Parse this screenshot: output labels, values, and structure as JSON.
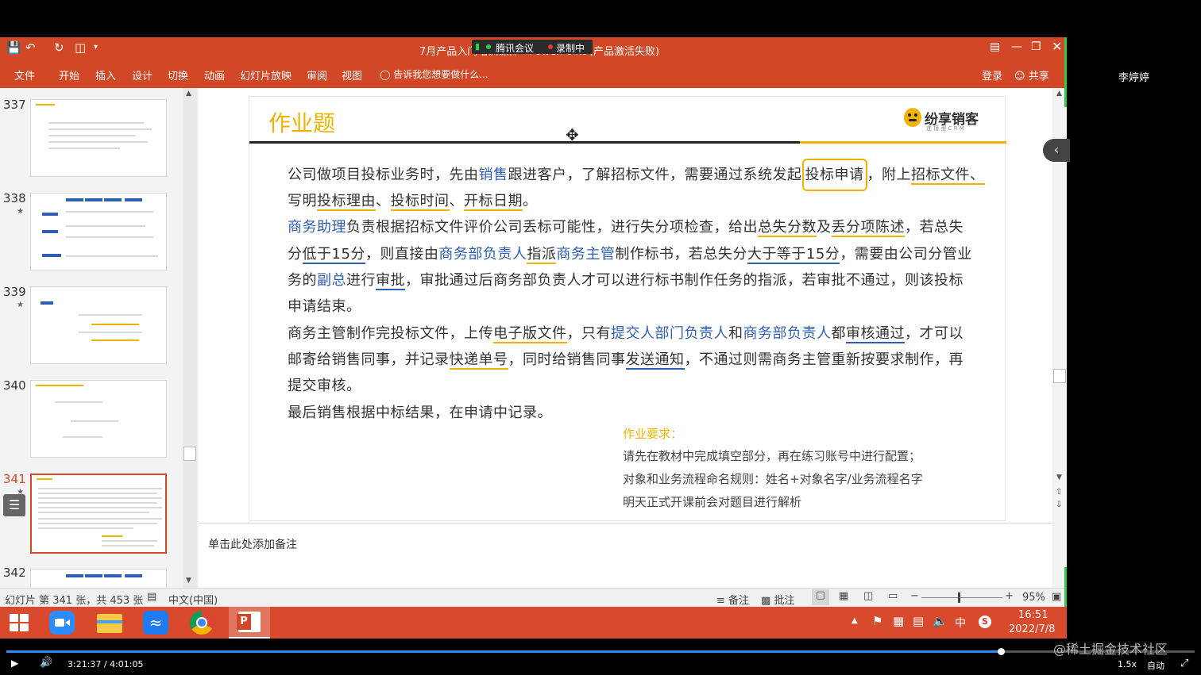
{
  "window": {
    "title": "7月产品入门培训课件 - PowerPoint (产品激活失败)",
    "login": "登录",
    "share": "共享"
  },
  "meeting": {
    "app": "腾讯会议",
    "recording": "录制中"
  },
  "participant": "李婷婷",
  "ribbon_tabs": [
    "文件",
    "开始",
    "插入",
    "设计",
    "切换",
    "动画",
    "幻灯片放映",
    "审阅",
    "视图"
  ],
  "tellme": "告诉我您想要做什么...",
  "thumbnails": [
    {
      "num": "337",
      "star": ""
    },
    {
      "num": "338",
      "star": "★"
    },
    {
      "num": "339",
      "star": "★"
    },
    {
      "num": "340",
      "star": ""
    },
    {
      "num": "341",
      "star": "★"
    },
    {
      "num": "342",
      "star": ""
    }
  ],
  "slide": {
    "title": "作业题",
    "logo_text": "纷享销客",
    "logo_sub": "连 接 型 C R M",
    "paragraph_lines": {
      "l1": {
        "a": "公司做项目投标业务时，先由",
        "b": "销售",
        "c": "跟进客户，了解招标文件，需要通过系统发起",
        "d": "投标申请",
        "e": "，附上",
        "f": "招标文件、"
      },
      "l2": {
        "a": "写明",
        "b": "投标理由",
        "c": "、",
        "d": "投标时间",
        "e": "、",
        "f": "开标日期",
        "g": "。"
      },
      "l3": {
        "a": "商务助理",
        "b": "负责根据招标文件评价公司丢标可能性，进行失分项检查，给出",
        "c": "总失分数",
        "d": "及",
        "e": "丢分项陈述",
        "f": "，若总失"
      },
      "l4": {
        "a": "分",
        "b": "低于15分",
        "c": "，则直接由",
        "d": "商务部负责人",
        "e": "指派",
        "f": "商务主管",
        "g": "制作标书，若总失分",
        "h": "大于等于15分",
        "i": "，需要由公司分管业"
      },
      "l5": {
        "a": "务的",
        "b": "副总",
        "c": "进行",
        "d": "审批",
        "e": "，审批通过后商务部负责人才可以进行标书制作任务的指派，若审批不通过，则该投标"
      },
      "l6": {
        "a": "申请结束。"
      },
      "l7": {
        "a": "商务主管制作完投标文件，上传",
        "b": "电子版文件",
        "c": "，只有",
        "d": "提交人部门负责人",
        "e": "和",
        "f": "商务部负责人",
        "g": "都",
        "h": "审核通过",
        "i": "，才可以"
      },
      "l8": {
        "a": "邮寄给销售同事，并记录",
        "b": "快递单号",
        "c": "，同时给销售同事",
        "d": "发送通知",
        "e": "，不通过则需商务主管重新按要求制作，再"
      },
      "l9": {
        "a": "提交审核。"
      },
      "l10": {
        "a": "最后销售根据中标结果，在申请中记录。"
      }
    },
    "requirements": {
      "heading": "作业要求：",
      "items": [
        "请先在教材中完成填空部分，再在练习账号中进行配置；",
        "对象和业务流程命名规则：姓名+对象名字/业务流程名字",
        "明天正式开课前会对题目进行解析"
      ]
    }
  },
  "notes_placeholder": "单击此处添加备注",
  "status": {
    "slide_info": "幻灯片 第 341 张，共 453 张",
    "language": "中文(中国)",
    "notes_btn": "备注",
    "comments_btn": "批注",
    "zoom": "95%",
    "zoom_minus": "−",
    "zoom_plus": "+"
  },
  "taskbar": {
    "time": "16:51",
    "date": "2022/7/8",
    "ime": "中",
    "icons": [
      "windows-start",
      "zoom-app",
      "file-explorer",
      "feishu-app",
      "chrome",
      "powerpoint"
    ]
  },
  "video": {
    "time": "3:21:37 / 4:01:05",
    "progress": 0.837,
    "speed": "1.5x",
    "quality": "自动",
    "watermark": "@稀土掘金技术社区"
  },
  "colors": {
    "ppt_accent": "#d24726",
    "title_yellow": "#f0b400",
    "keyword_blue": "#2f5fb3",
    "selected_thumb": "#d24726"
  }
}
